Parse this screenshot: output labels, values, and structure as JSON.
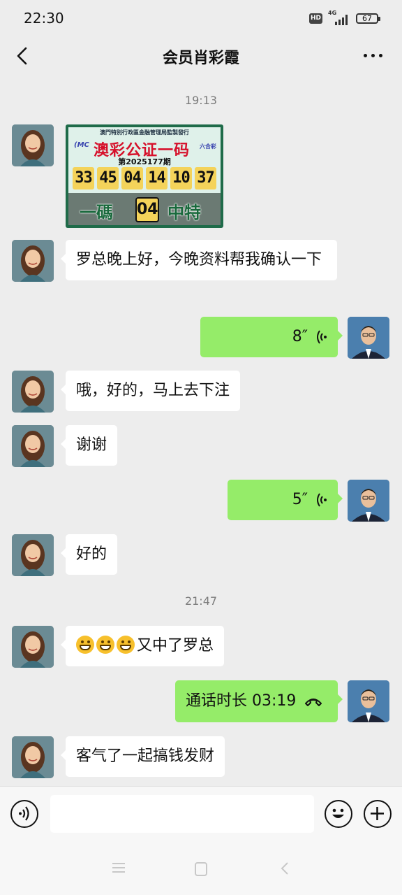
{
  "status_bar": {
    "time": "22:30",
    "hd": "HD",
    "network": "4G",
    "battery": "67"
  },
  "header": {
    "title": "会员肖彩霞"
  },
  "timestamps": [
    "19:13",
    "21:47"
  ],
  "lottery_image": {
    "header": "澳門特別行政區金融管理局監製發行",
    "logo_left": "(MC",
    "title": "澳彩公证一码",
    "logo_right": "六合彩",
    "period": "第2025177期",
    "numbers": [
      "33",
      "45",
      "04",
      "14",
      "10",
      "37"
    ],
    "bottom_left": "一碼",
    "special": "04",
    "bottom_right": "中特"
  },
  "messages": [
    {
      "text": "罗总晚上好，今晚资料帮我确认一下"
    },
    {
      "duration": "8″"
    },
    {
      "text": "哦，好的，马上去下注"
    },
    {
      "text": "谢谢"
    },
    {
      "duration": "5″"
    },
    {
      "text": "好的"
    },
    {
      "text": "又中了罗总"
    },
    {
      "text": "通话时长 03:19"
    },
    {
      "text": "客气了一起搞钱发财"
    }
  ],
  "icons": {
    "back": "back-arrow-icon",
    "more": "more-icon",
    "voice": "voice-icon",
    "emoji": "emoji-icon",
    "plus": "plus-icon",
    "call": "phone-hangup-icon"
  }
}
